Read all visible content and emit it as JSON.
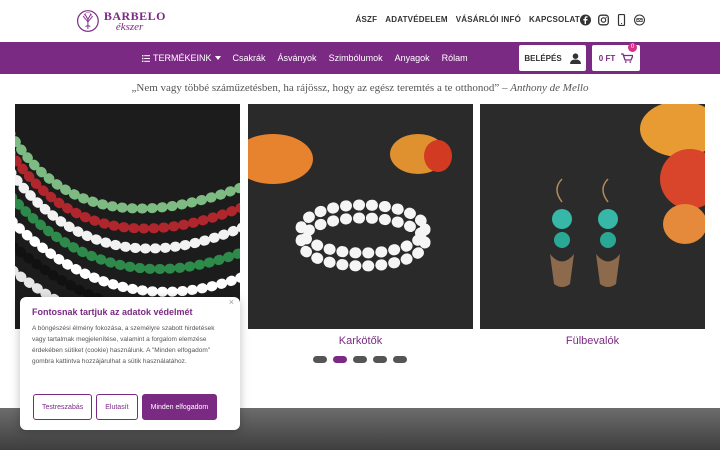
{
  "brand": {
    "name": "BARBELO",
    "sub": "ékszer"
  },
  "top_links": [
    "ÁSZF",
    "ADATVÉDELEM",
    "VÁSÁRLÓI INFÓ",
    "KAPCSOLAT"
  ],
  "social_icons": [
    "facebook-icon",
    "instagram-icon",
    "phone-icon",
    "mail-icon"
  ],
  "nav": {
    "items": [
      "TERMÉKEINK",
      "Csakrák",
      "Ásványok",
      "Szimbólumok",
      "Anyagok",
      "Rólam"
    ],
    "login_label": "BELÉPÉS",
    "cart_label": "0 FT",
    "cart_count": "0"
  },
  "quote": {
    "text": "„Nem vagy többé száműzetésben, ha rájössz, hogy az egész teremtés a te otthonod”",
    "dash": " – ",
    "author": "Anthony de Mello"
  },
  "carousel": {
    "captions": [
      "",
      "Karkötők",
      "Fülbevalók"
    ],
    "dots": 5,
    "active_dot": 2
  },
  "cookie": {
    "title": "Fontosnak tartjuk az adatok védelmét",
    "body": "A böngészési élmény fokozása, a személyre szabott hirdetések vagy tartalmak megjelenítése, valamint a forgalom elemzése érdekében sütiket (cookie) használunk. A \"Minden elfogadom\" gombra kattintva hozzájárulhat a sütik használatához.",
    "close": "×",
    "btn_customize": "Testreszabás",
    "btn_reject": "Elutasít",
    "btn_accept": "Minden elfogadom"
  },
  "colors": {
    "brand": "#7b2a83",
    "text": "#333333"
  }
}
